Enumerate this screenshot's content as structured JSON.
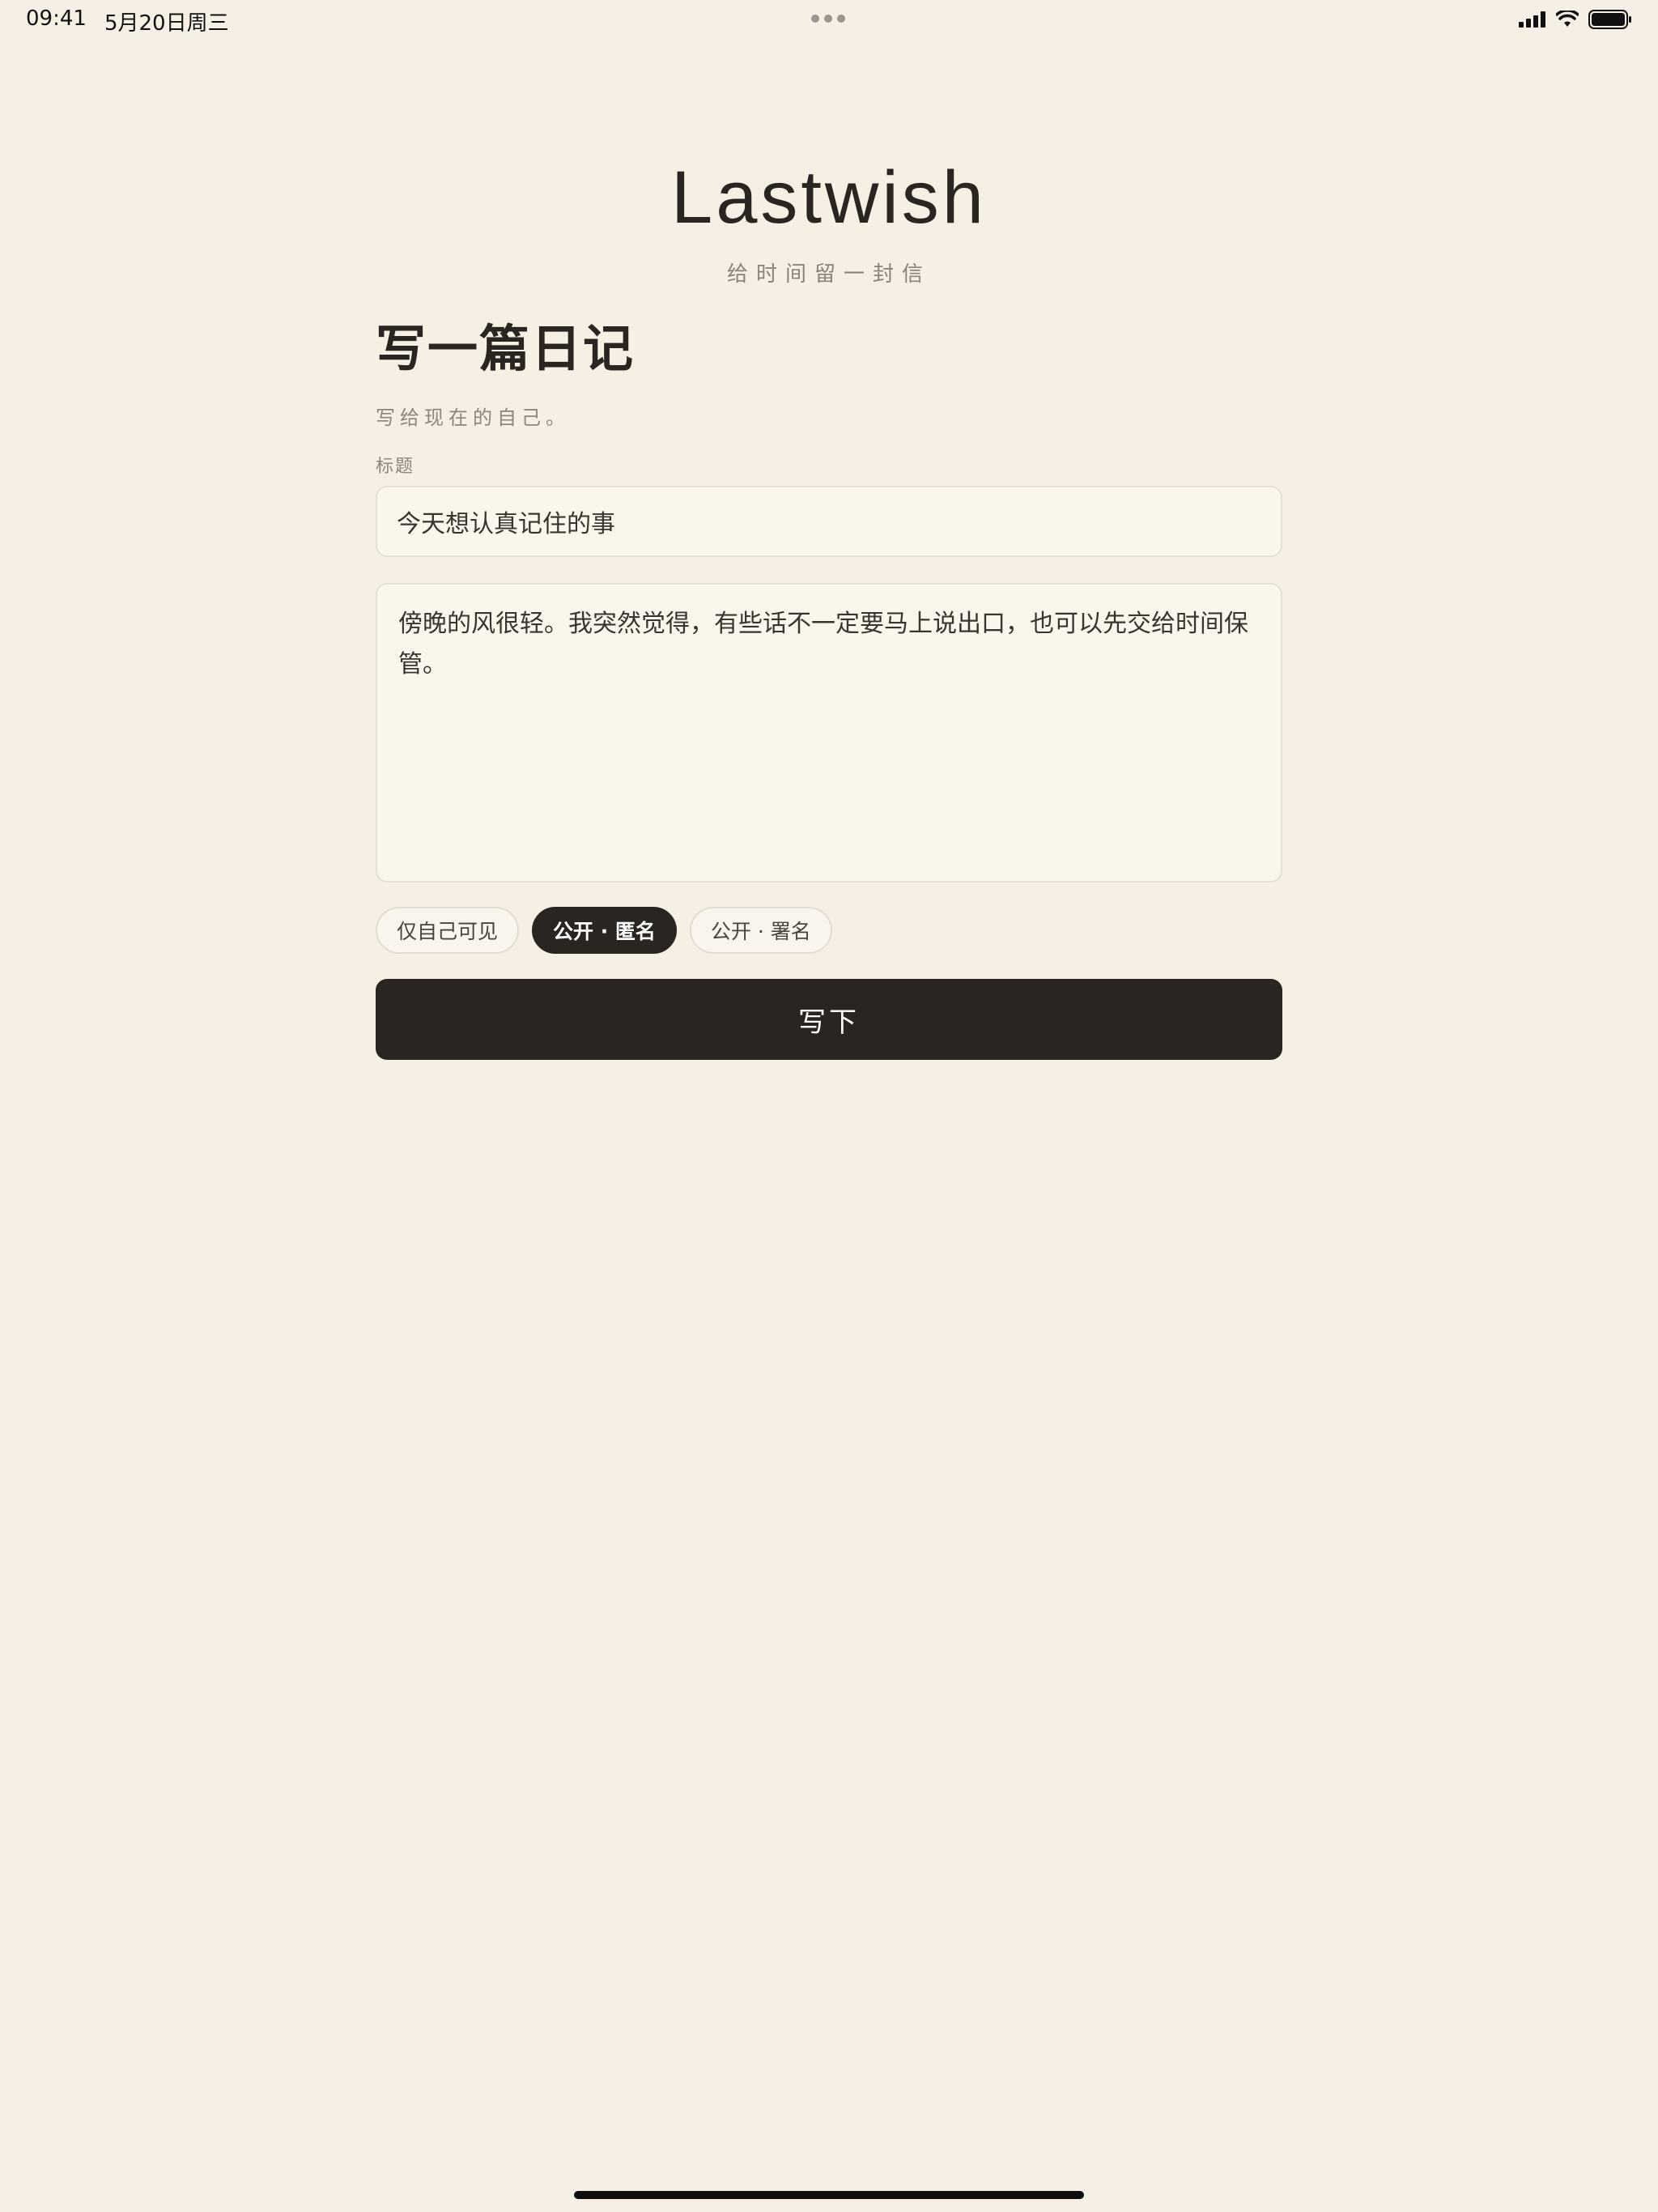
{
  "status_bar": {
    "time": "09:41",
    "date": "5月20日周三",
    "icons": [
      "cellular-signal-icon",
      "wifi-icon",
      "battery-icon"
    ]
  },
  "header": {
    "brand": "Lastwish",
    "tagline": "给时间留一封信"
  },
  "form": {
    "page_title": "写一篇日记",
    "page_subtitle": "写给现在的自己。",
    "title_label": "标题",
    "title_value": "今天想认真记住的事",
    "body_value": "傍晚的风很轻。我突然觉得，有些话不一定要马上说出口，也可以先交给时间保管。",
    "visibility_options": [
      {
        "label": "仅自己可见",
        "selected": false
      },
      {
        "label": "公开 · 匿名",
        "selected": true
      },
      {
        "label": "公开 · 署名",
        "selected": false
      }
    ],
    "submit_label": "写下"
  },
  "colors": {
    "background": "#F5EFE4",
    "field_background": "#FAF6EC",
    "accent_dark": "#2A2520",
    "muted_text": "#8E867D"
  }
}
